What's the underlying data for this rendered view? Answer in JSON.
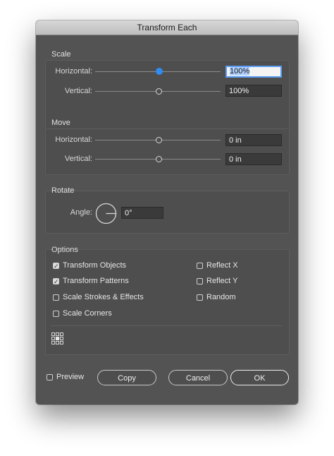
{
  "window": {
    "title": "Transform Each"
  },
  "scale": {
    "title": "Scale",
    "horizontal_label": "Horizontal:",
    "horizontal_value": "100%",
    "vertical_label": "Vertical:",
    "vertical_value": "100%"
  },
  "move": {
    "title": "Move",
    "horizontal_label": "Horizontal:",
    "horizontal_value": "0 in",
    "vertical_label": "Vertical:",
    "vertical_value": "0 in"
  },
  "rotate": {
    "title": "Rotate",
    "angle_label": "Angle:",
    "angle_value": "0°"
  },
  "options": {
    "title": "Options",
    "items": [
      {
        "label": "Transform Objects",
        "checked": true
      },
      {
        "label": "Transform Patterns",
        "checked": true
      },
      {
        "label": "Scale Strokes & Effects",
        "checked": false
      },
      {
        "label": "Scale Corners",
        "checked": false
      },
      {
        "label": "Reflect X",
        "checked": false
      },
      {
        "label": "Reflect Y",
        "checked": false
      },
      {
        "label": "Random",
        "checked": false
      }
    ],
    "reference_point_icon": "reference-point-grid-icon"
  },
  "footer": {
    "preview_label": "Preview",
    "preview_checked": false,
    "copy_label": "Copy",
    "cancel_label": "Cancel",
    "ok_label": "OK"
  },
  "colors": {
    "accent": "#2f8cf0",
    "dialog_bg": "#535353"
  }
}
